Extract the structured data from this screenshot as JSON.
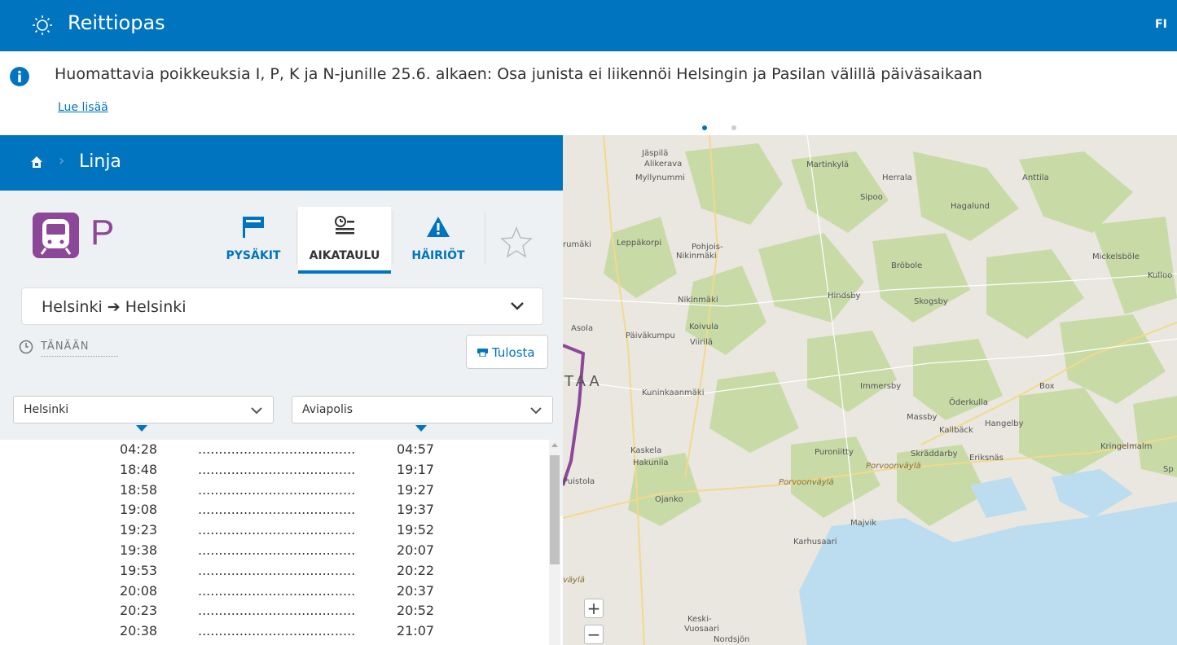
{
  "header": {
    "brand": "Reittiopas",
    "language": "FI"
  },
  "notice": {
    "text": "Huomattavia poikkeuksia I, P, K ja N-junille 25.6. alkaen: Osa junista ei liikennöi Helsingin ja Pasilan välillä päiväsaikaan",
    "link": "Lue lisää"
  },
  "panel": {
    "title": "Linja",
    "route": "P",
    "tabs": {
      "stops": "PYSÄKIT",
      "timetable": "AIKATAULU",
      "disruptions": "HÄIRIÖT"
    },
    "direction": "Helsinki ➔ Helsinki",
    "date": "TÄNÄÄN",
    "print": "Tulosta",
    "from_stop": "Helsinki",
    "to_stop": "Aviapolis",
    "dots": "......................................",
    "timetable": [
      {
        "dep": "04:28",
        "arr": "04:57"
      },
      {
        "dep": "18:48",
        "arr": "19:17"
      },
      {
        "dep": "18:58",
        "arr": "19:27"
      },
      {
        "dep": "19:08",
        "arr": "19:37"
      },
      {
        "dep": "19:23",
        "arr": "19:52"
      },
      {
        "dep": "19:38",
        "arr": "20:07"
      },
      {
        "dep": "19:53",
        "arr": "20:22"
      },
      {
        "dep": "20:08",
        "arr": "20:37"
      },
      {
        "dep": "20:23",
        "arr": "20:52"
      },
      {
        "dep": "20:38",
        "arr": "21:07"
      }
    ]
  },
  "map": {
    "labels": [
      "Jäspilä",
      "Alikerava",
      "Myllynummi",
      "Martinkylä",
      "Herrala",
      "Anttila",
      "Sipoo",
      "Hagalund",
      "Leppäkorpi",
      "Pohjois-",
      "Nikinmäki",
      "Bröbole",
      "Mickelsböle",
      "Kulloo",
      "Nikinmäki",
      "Hindsby",
      "Skogsby",
      "Asola",
      "Koivula",
      "Päiväkumpu",
      "Viirilä",
      "Kuninkaanmäki",
      "Immersby",
      "Box",
      "Öderkulla",
      "Massby",
      "Hangelby",
      "Kallbäck",
      "Kaskela",
      "Puroniitty",
      "Skräddarby",
      "Eriksnäs",
      "Kringelmalm",
      "Hakunila",
      "Porvoonväylä",
      "Porvoonväylä",
      "Ojanko",
      "Majvik",
      "Karhusaari",
      "Keski-",
      "Vuosaari",
      "Nordsjön",
      "Puistola",
      "rumäki",
      "väylä",
      "Sp",
      "TAA"
    ],
    "zoom_in": "+",
    "zoom_out": "−",
    "route_color": "#8c4799"
  }
}
